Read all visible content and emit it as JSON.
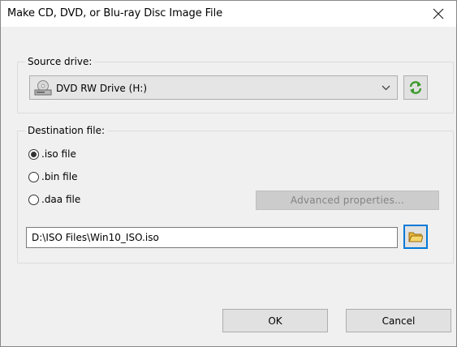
{
  "window": {
    "title": "Make CD, DVD, or Blu-ray Disc Image File"
  },
  "source": {
    "group_label": "Source drive:",
    "selected_drive": "DVD RW Drive (H:)"
  },
  "destination": {
    "group_label": "Destination file:",
    "formats": [
      {
        "label": ".iso file",
        "checked": true
      },
      {
        "label": ".bin file",
        "checked": false
      },
      {
        "label": ".daa file",
        "checked": false
      }
    ],
    "advanced_label": "Advanced properties...",
    "file_path": "D:\\ISO Files\\Win10_ISO.iso"
  },
  "buttons": {
    "ok": "OK",
    "cancel": "Cancel"
  },
  "icons": {
    "close": "close-icon",
    "drive": "optical-drive-icon",
    "dropdown": "chevron-down-icon",
    "refresh": "refresh-icon",
    "browse": "folder-icon"
  },
  "colors": {
    "focus_border": "#0078d7",
    "refresh_green": "#3b9a2a",
    "folder_yellow": "#e8b73a"
  }
}
